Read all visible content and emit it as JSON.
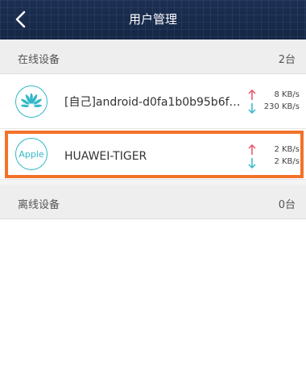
{
  "header": {
    "title": "用户管理",
    "back_icon": "chevron-left-icon"
  },
  "online_section": {
    "title": "在线设备",
    "count": "2台"
  },
  "devices": [
    {
      "name": "[自己]android-d0fa1b0b95b6f6...",
      "icon": "huawei-logo-icon",
      "upload_speed": "8 KB/s",
      "download_speed": "230 KB/s"
    },
    {
      "name": "HUAWEI-TIGER",
      "icon": "apple-logo-icon",
      "icon_text": "Apple",
      "upload_speed": "2 KB/s",
      "download_speed": "2 KB/s",
      "highlighted": true
    }
  ],
  "offline_section": {
    "title": "离线设备",
    "count": "0台"
  },
  "colors": {
    "header_bg": "#1d2f52",
    "accent_teal": "#32b8c8",
    "upload_arrow": "#e8546a",
    "download_arrow": "#32b8c8",
    "highlight_border": "#f2722a"
  }
}
